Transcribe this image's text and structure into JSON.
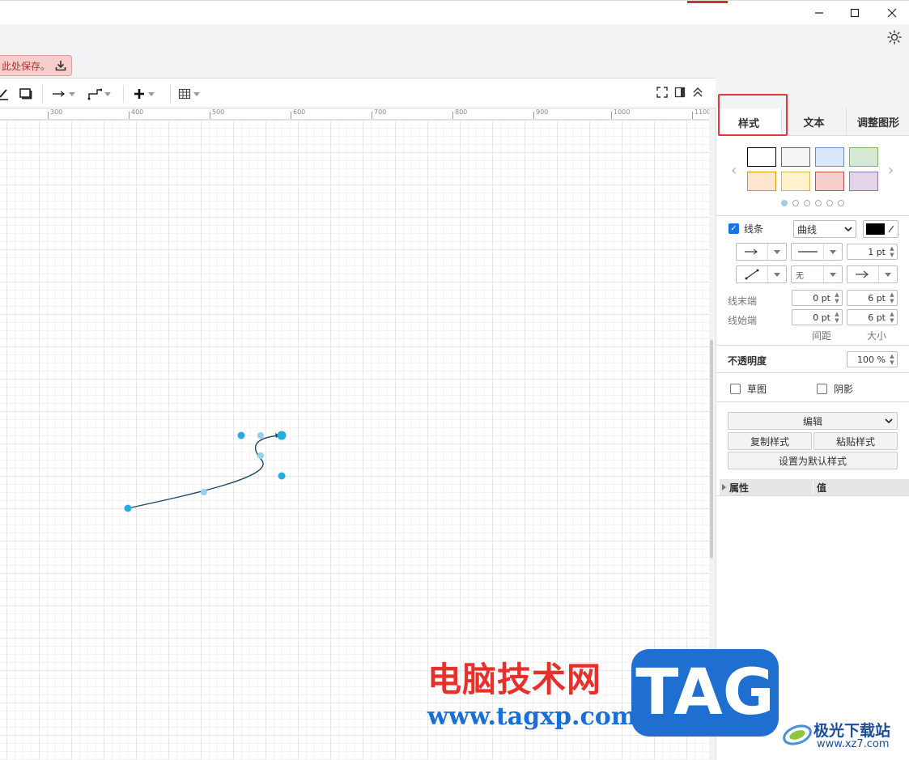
{
  "window": {
    "minimize_glyph": "—",
    "maximize_glyph": "☐",
    "close_glyph": "✕"
  },
  "save_banner": {
    "text": "此处保存。"
  },
  "toolbar": {
    "icons": [
      "pencil-icon",
      "shadow-icon",
      "connector-arrow-icon",
      "waypoint-icon",
      "insert-plus-icon",
      "table-icon",
      "fullscreen-icon",
      "format-panel-icon",
      "collapse-icon"
    ]
  },
  "ruler": {
    "ticks": [
      "300",
      "400",
      "500",
      "600",
      "700",
      "800",
      "900",
      "1000",
      "1100"
    ]
  },
  "panel": {
    "tabs": [
      {
        "label": "样式"
      },
      {
        "label": "文本"
      },
      {
        "label": "调整图形"
      }
    ],
    "swatches": [
      {
        "fill": "#ffffff",
        "stroke": "#000000"
      },
      {
        "fill": "#f5f5f5",
        "stroke": "#666666"
      },
      {
        "fill": "#dae8fc",
        "stroke": "#6c8ebf"
      },
      {
        "fill": "#d5e8d4",
        "stroke": "#82b366"
      },
      {
        "fill": "#ffe6cc",
        "stroke": "#d79b00"
      },
      {
        "fill": "#fff2cc",
        "stroke": "#d6b656"
      },
      {
        "fill": "#f8cecc",
        "stroke": "#b85450"
      },
      {
        "fill": "#e1d5e7",
        "stroke": "#9673a6"
      }
    ],
    "line": {
      "label": "线条",
      "style": "曲线",
      "color": "#000000",
      "width": "1 pt",
      "waypoint": "无"
    },
    "line_end": {
      "label": "线末端",
      "spacing": "0 pt",
      "size": "6 pt"
    },
    "line_start": {
      "label": "线始端",
      "spacing": "0 pt",
      "size": "6 pt"
    },
    "col_spacing": "间距",
    "col_size": "大小",
    "opacity": {
      "label": "不透明度",
      "value": "100 %"
    },
    "sketch": "草图",
    "shadow": "阴影",
    "edit": "编辑",
    "copy_style": "复制样式",
    "paste_style": "粘贴样式",
    "set_default": "设置为默认样式",
    "props_header": {
      "property": "属性",
      "value": "值"
    }
  },
  "watermark": {
    "cn": "电脑技术网",
    "url": "www.tagxp.com",
    "tag": "TAG",
    "site": "极光下载站",
    "site_url": "www.xz7.com"
  },
  "colors": {
    "selection": "#29abe2",
    "accent": "#1a73e8",
    "highlight": "#e53935"
  }
}
